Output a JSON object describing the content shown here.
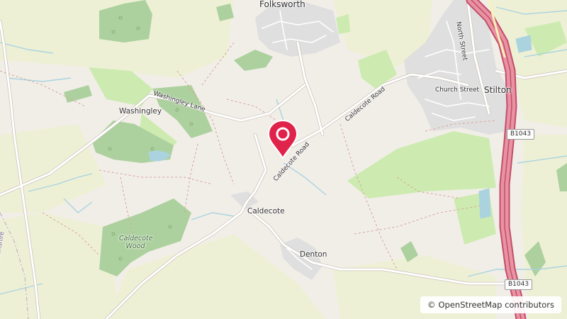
{
  "places": {
    "folksworth": "Folksworth",
    "stilton": "Stilton",
    "washingley": "Washingley",
    "caldecote": "Caldecote",
    "denton": "Denton",
    "caldecote_wood": "Caldecote Wood",
    "county_edge": "gdonshire"
  },
  "roads": {
    "north_street": "North Street",
    "church_street": "Church Street",
    "washingley_lane": "Washingley Lane",
    "caldecote_road_upper": "Caldecote Road",
    "caldecote_road_lower": "Caldecote Road",
    "b1043_north": "B1043",
    "b1043_south": "B1043"
  },
  "marker": {
    "icon": "map-pin-icon",
    "color": "#e0234b"
  },
  "attribution": {
    "symbol": "©",
    "text": "OpenStreetMap contributors"
  },
  "colors": {
    "land": "#f1eee8",
    "farmland": "#eef0d6",
    "forest": "#add19e",
    "grass": "#cdebb0",
    "water": "#aad3df",
    "residential": "#e0dfdf",
    "motorway_fill": "#e892a2",
    "motorway_casing": "#c24e6b",
    "road": "#ffffff"
  }
}
